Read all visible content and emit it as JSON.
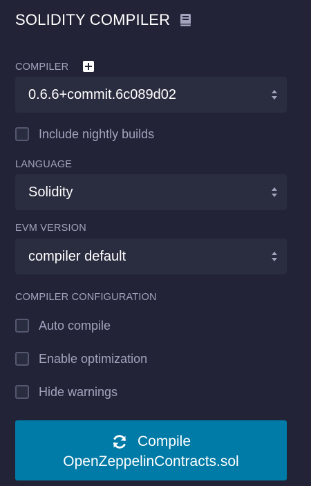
{
  "header": {
    "title": "SOLIDITY COMPILER",
    "icon": "book-icon"
  },
  "compiler": {
    "label": "COMPILER",
    "add_icon": "plus-square-icon",
    "selected_version": "0.6.6+commit.6c089d02",
    "nightly_label": "Include nightly builds",
    "nightly_checked": false
  },
  "language": {
    "label": "LANGUAGE",
    "selected": "Solidity"
  },
  "evm": {
    "label": "EVM VERSION",
    "selected": "compiler default"
  },
  "config": {
    "label": "COMPILER CONFIGURATION",
    "options": [
      {
        "label": "Auto compile",
        "checked": false
      },
      {
        "label": "Enable optimization",
        "checked": false
      },
      {
        "label": "Hide warnings",
        "checked": false
      }
    ]
  },
  "compile_button": {
    "label": "Compile",
    "file": "OpenZeppelinContracts.sol",
    "icon": "refresh-icon"
  },
  "colors": {
    "background": "#222336",
    "field": "#2a2c3f",
    "accent": "#007aa6",
    "label": "#a2a3bd"
  }
}
